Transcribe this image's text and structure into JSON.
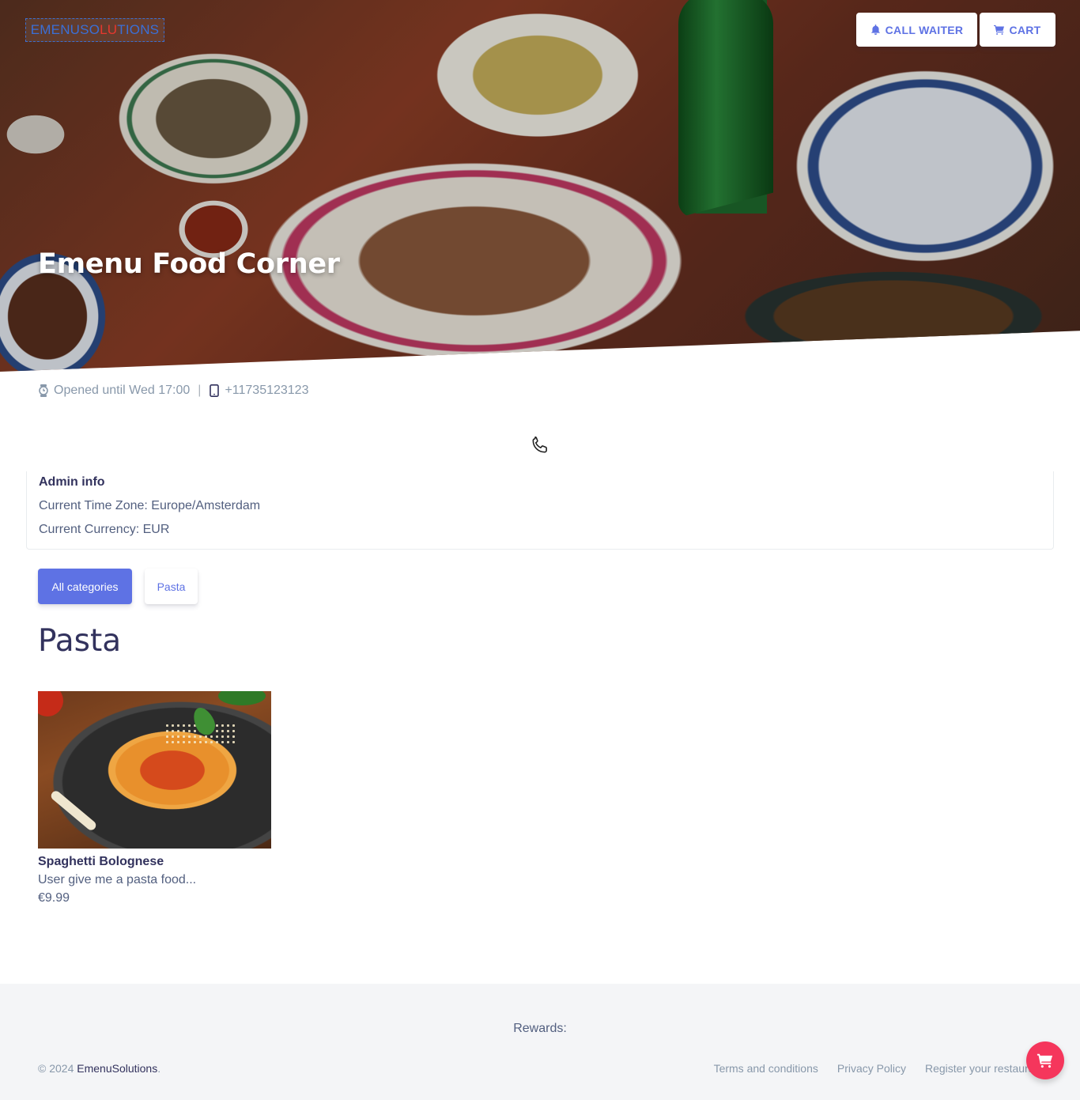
{
  "header": {
    "logo": {
      "part1": "EMENUSO",
      "part2": "LU",
      "part3": "TIONS"
    },
    "call_waiter_label": "CALL WAITER",
    "call_waiter_icon": "bell-icon",
    "cart_label": "CART",
    "cart_icon": "shopping-cart-icon",
    "restaurant_name": "Emenu Food Corner"
  },
  "info": {
    "hours_icon": "watch-icon",
    "hours": "Opened until Wed 17:00",
    "separator": "|",
    "phone_icon": "mobile-icon",
    "phone": "+11735123123",
    "call_icon": "phone-icon"
  },
  "admin": {
    "title": "Admin info",
    "timezone": "Current Time Zone: Europe/Amsterdam",
    "currency": "Current Currency: EUR"
  },
  "categories": {
    "items": [
      {
        "label": "All categories",
        "active": true
      },
      {
        "label": "Pasta",
        "active": false
      }
    ]
  },
  "section": {
    "title": "Pasta",
    "items": [
      {
        "name": "Spaghetti Bolognese",
        "description": "User give me a pasta food...",
        "price": "€9.99"
      }
    ]
  },
  "footer": {
    "rewards": "Rewards:",
    "copyright_prefix": "© 2024 ",
    "copyright_brand": "EmenuSolutions",
    "copyright_suffix": ".",
    "links": [
      "Terms and conditions",
      "Privacy Policy",
      "Register your restaurant"
    ]
  },
  "fab": {
    "icon": "shopping-cart-icon"
  },
  "colors": {
    "primary": "#5e72e4",
    "danger": "#f5365c",
    "heading": "#32325d",
    "muted": "#8898aa"
  }
}
